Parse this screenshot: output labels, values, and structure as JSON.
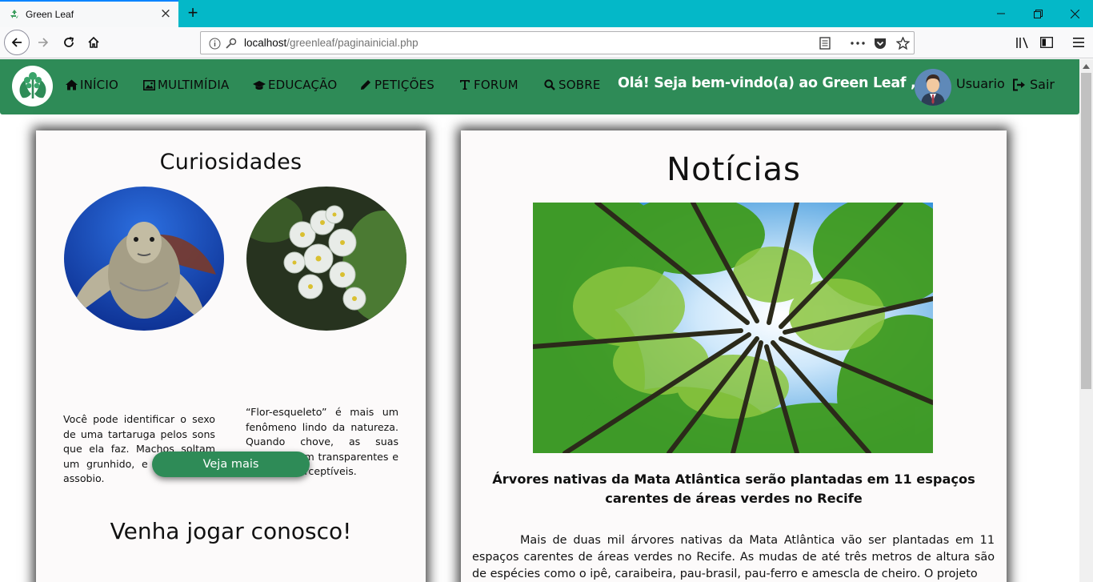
{
  "browser": {
    "tab_title": "Green Leaf",
    "url_host": "localhost",
    "url_path": "/greenleaf/paginainicial.php",
    "icons": [
      "recycle-icon",
      "close-icon",
      "plus-icon",
      "back-icon",
      "forward-icon",
      "reload-icon",
      "home-icon",
      "info-icon",
      "key-icon",
      "reader-icon",
      "more-icon",
      "pocket-icon",
      "star-icon",
      "library-icon",
      "sidebar-icon",
      "menu-icon",
      "minimize-icon",
      "restore-icon"
    ]
  },
  "header": {
    "nav": [
      {
        "label": "INÍCIO",
        "icon": "home-icon"
      },
      {
        "label": "MULTIMÍDIA",
        "icon": "image-icon"
      },
      {
        "label": "EDUCAÇÃO",
        "icon": "graduation-cap-icon"
      },
      {
        "label": "PETIÇÕES",
        "icon": "pencil-icon"
      },
      {
        "label": "FORUM",
        "icon": "text-icon"
      },
      {
        "label": "SOBRE",
        "icon": "search-icon"
      }
    ],
    "welcome": "Olá! Seja bem-vindo(a) ao Green Leaf ,",
    "username": "Usuario",
    "logout": "Sair",
    "brand_color": "#2e8b57"
  },
  "curiosities": {
    "title": "Curiosidades",
    "facts": [
      {
        "image": "sea-turtle",
        "text": "Você pode identificar o sexo de uma tartaruga pelos sons que ela faz. Machos soltam um grunhido, e fêmeas um assobio."
      },
      {
        "image": "skeleton-flower",
        "text": "“Flor-esqueleto” é mais um fenômeno lindo da natureza. Quando chove, as suas pétalas ficam transparentes e quase imperceptíveis."
      }
    ],
    "more_button": "Veja mais",
    "game_title": "Venha jogar conosco!"
  },
  "news": {
    "title": "Notícias",
    "image": "forest-canopy",
    "headline": "Árvores nativas da Mata Atlântica serão plantadas em 11 espaços carentes de áreas verdes no Recife",
    "body": "Mais de duas mil árvores nativas da Mata Atlântica vão ser plantadas em 11 espaços carentes de áreas verdes no Recife. As mudas de até três metros de altura são de espécies como o ipê, caraibeira, pau-brasil, pau-ferro e amescla de cheiro. O projeto"
  }
}
